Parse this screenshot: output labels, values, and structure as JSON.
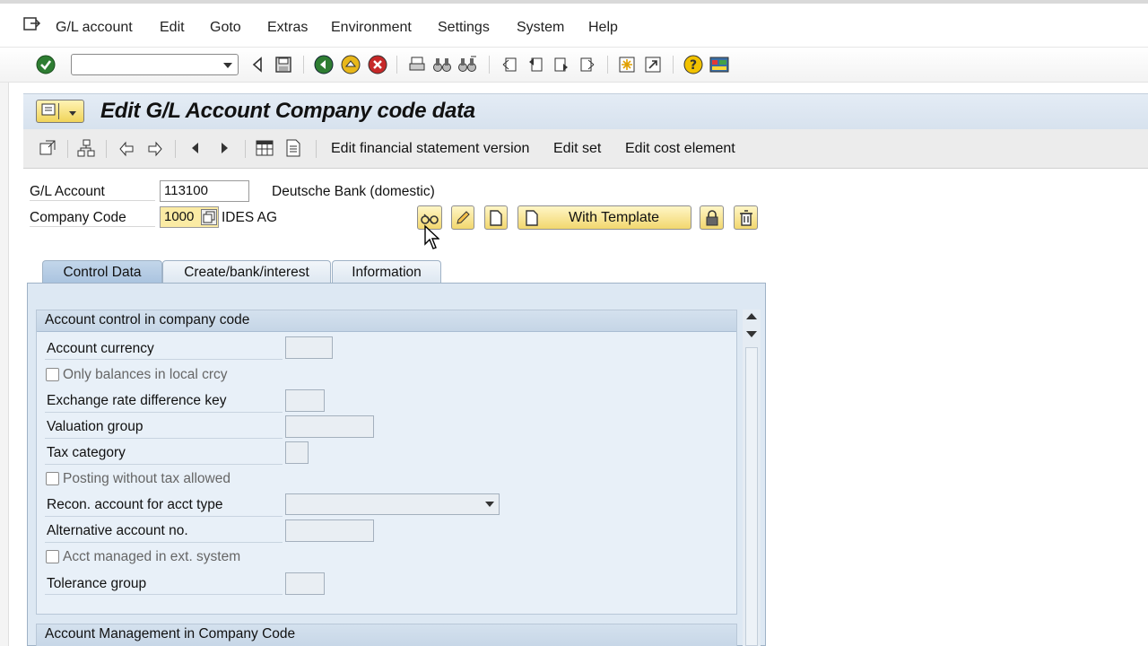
{
  "menu": {
    "items": [
      {
        "label": "G/L account",
        "mn": "G",
        "rest": "/L account",
        "underline_first": true
      },
      {
        "label": "Edit"
      },
      {
        "label": "Goto"
      },
      {
        "label": "Extras"
      },
      {
        "label": "Environment"
      },
      {
        "label": "Settings"
      },
      {
        "label": "System"
      },
      {
        "label": "Help"
      }
    ]
  },
  "system_toolbar": {
    "command_field_value": ""
  },
  "title": {
    "text": "Edit G/L Account Company code data"
  },
  "app_toolbar": {
    "edit_fs_version": "Edit financial statement version",
    "edit_set": "Edit set",
    "edit_cost_element": "Edit cost element"
  },
  "header": {
    "gl_account_label": "G/L Account",
    "gl_account_value": "113100",
    "gl_account_desc": "Deutsche Bank (domestic)",
    "company_code_label": "Company Code",
    "company_code_value": "1000",
    "company_code_desc": "IDES AG",
    "with_template_label": "With Template"
  },
  "tabs": [
    {
      "label": "Control Data",
      "active": true
    },
    {
      "label": "Create/bank/interest",
      "active": false
    },
    {
      "label": "Information",
      "active": false
    }
  ],
  "control_group": {
    "title": "Account control in company code",
    "account_currency": "Account currency",
    "only_balances": "Only balances in local crcy",
    "exchange_rate_key": "Exchange rate difference key",
    "valuation_group": "Valuation group",
    "tax_category": "Tax category",
    "posting_without_tax": "Posting without tax allowed",
    "recon_account": "Recon. account for acct type",
    "alternative_account": "Alternative account no.",
    "acct_managed_ext": "Acct managed in ext. system",
    "tolerance_group": "Tolerance group"
  },
  "management_group": {
    "title": "Account Management in Company Code"
  },
  "colors": {
    "title_bg": "#d7e2ee",
    "tab_active": "#a9c3df",
    "button_yellow": "#f2d76e",
    "field_yellow": "#fbeba4"
  }
}
